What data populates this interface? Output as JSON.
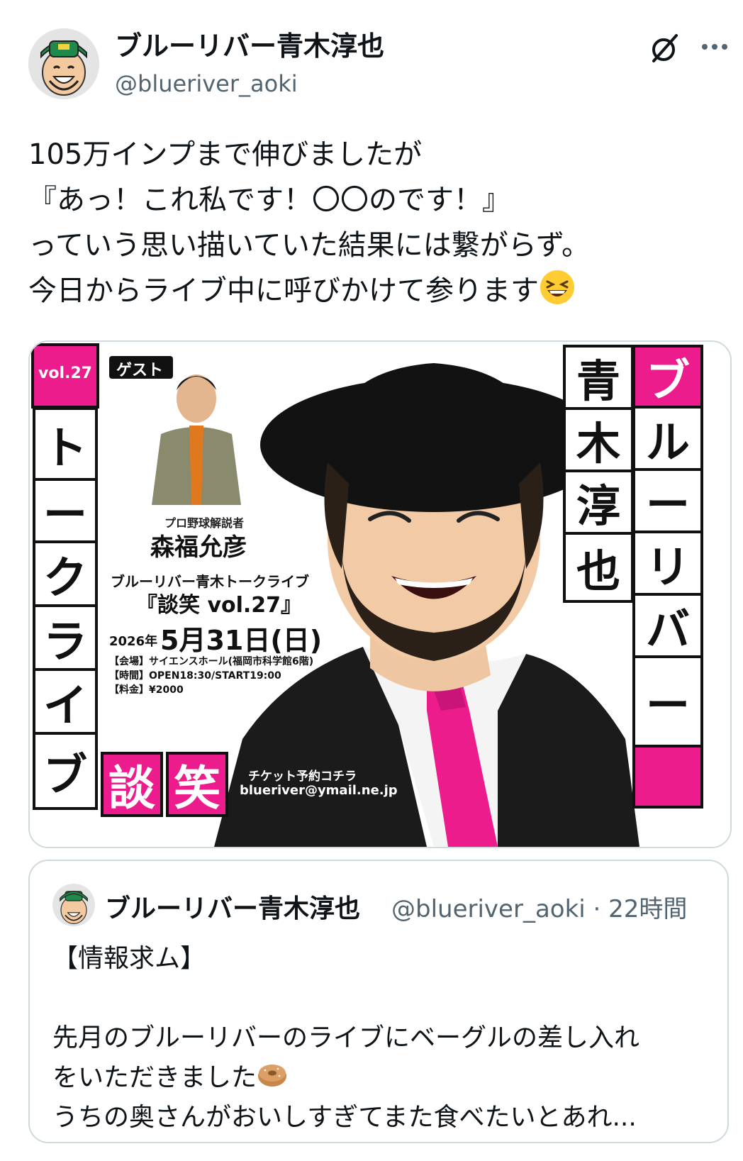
{
  "author": {
    "display_name": "ブルーリバー青木淳也",
    "handle": "@blueriver_aoki"
  },
  "header_icons": [
    "grok-icon",
    "more-icon"
  ],
  "tweet": {
    "line1": "105万インプまで伸びましたが",
    "line2": "『あっ！これ私です！〇〇のです！』",
    "line3": "っていう思い描いていた結果には繋がらず。",
    "line4": "今日からライブ中に呼びかけて参ります",
    "emoji": "grinning-squinting-face"
  },
  "poster": {
    "vol_badge": "vol.27",
    "guest_label": "ゲスト",
    "left_vertical": [
      "ト",
      "ー",
      "ク",
      "ラ",
      "イ",
      "ブ"
    ],
    "right_vertical_outer": [
      "ブ",
      "ル",
      "ー",
      "リ",
      "バ",
      "ー"
    ],
    "right_vertical_inner": [
      "青",
      "木",
      "淳",
      "也"
    ],
    "guest_title": "プロ野球解説者",
    "guest_name": "森福允彦",
    "event_series": "ブルーリバー青木トークライブ",
    "event_name": "『談笑 vol.27』",
    "date_year": "2026年",
    "date_main": "5月31日(日)",
    "venue": "【会場】サイエンスホール(福岡市科学館6階)",
    "time": "【時間】OPEN18:30/START19:00",
    "fee": "【料金】¥2000",
    "logo_1": "談",
    "logo_2": "笑",
    "ticket_label": "チケット予約コチラ",
    "ticket_email": "blueriver@ymail.ne.jp",
    "colors": {
      "pink": "#ec1c8c",
      "black": "#111111"
    }
  },
  "quoted": {
    "display_name": "ブルーリバー青木淳也",
    "handle_time": "@blueriver_aoki · 22時間",
    "line1": "【情報求ム】",
    "line2": "",
    "line3": "先月のブルーリバーのライブにベーグルの差し入れ",
    "line4": "をいただきました",
    "line5": "うちの奥さんがおいしすぎてまた食べたいとあれ...",
    "emoji": "bagel"
  }
}
